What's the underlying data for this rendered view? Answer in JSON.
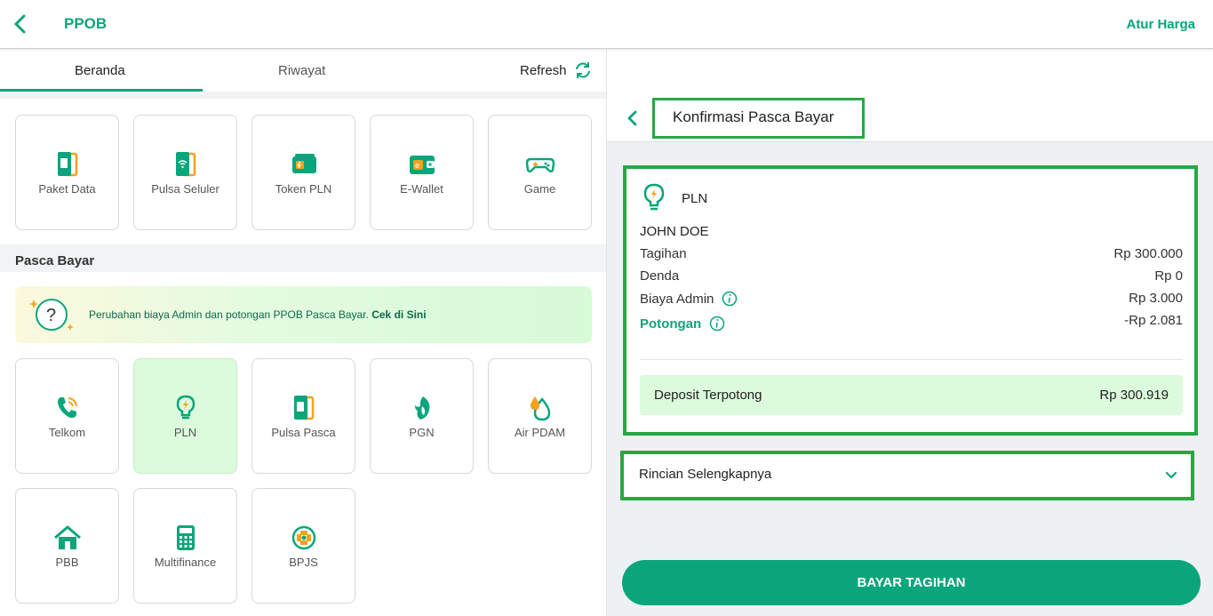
{
  "header": {
    "title": "PPOB",
    "action": "Atur Harga"
  },
  "tabs": [
    {
      "label": "Beranda",
      "active": true
    },
    {
      "label": "Riwayat",
      "active": false
    }
  ],
  "refresh": {
    "label": "Refresh"
  },
  "prabayar": {
    "items": [
      {
        "label": "Paket Data",
        "icon": "phone-card-icon"
      },
      {
        "label": "Pulsa Seluler",
        "icon": "wifi-phone-icon"
      },
      {
        "label": "Token PLN",
        "icon": "token-card-icon"
      },
      {
        "label": "E-Wallet",
        "icon": "wallet-icon"
      },
      {
        "label": "Game",
        "icon": "gamepad-icon"
      }
    ]
  },
  "pasca": {
    "section_label": "Pasca Bayar",
    "banner": {
      "text": "Perubahan biaya Admin dan potongan PPOB Pasca Bayar. ",
      "link": "Cek di Sini"
    },
    "items": [
      {
        "label": "Telkom",
        "icon": "telephone-icon"
      },
      {
        "label": "PLN",
        "icon": "lightbulb-icon",
        "selected": true
      },
      {
        "label": "Pulsa Pasca",
        "icon": "phone-card-icon"
      },
      {
        "label": "PGN",
        "icon": "gas-flame-icon"
      },
      {
        "label": "Air PDAM",
        "icon": "water-drop-icon"
      },
      {
        "label": "PBB",
        "icon": "house-icon"
      },
      {
        "label": "Multifinance",
        "icon": "calculator-icon"
      },
      {
        "label": "BPJS",
        "icon": "bpjs-logo-icon"
      }
    ]
  },
  "confirmation": {
    "title": "Konfirmasi Pasca Bayar",
    "provider": "PLN",
    "customer": "JOHN DOE",
    "rows": [
      {
        "label": "Tagihan",
        "value": "Rp 300.000"
      },
      {
        "label": "Denda",
        "value": "Rp 0"
      },
      {
        "label": "Biaya Admin",
        "value": "Rp 3.000"
      },
      {
        "label": "Potongan",
        "value": "-Rp 2.081"
      }
    ],
    "deposit": {
      "label": "Deposit Terpotong",
      "value": "Rp 300.919"
    },
    "details_label": "Rincian Selengkapnya",
    "pay_button": "BAYAR TAGIHAN"
  },
  "colors": {
    "primary": "#0aa57b",
    "highlight": "#27a844",
    "selected_bg": "#dcfbdc",
    "accent_orange": "#f5a11c"
  }
}
